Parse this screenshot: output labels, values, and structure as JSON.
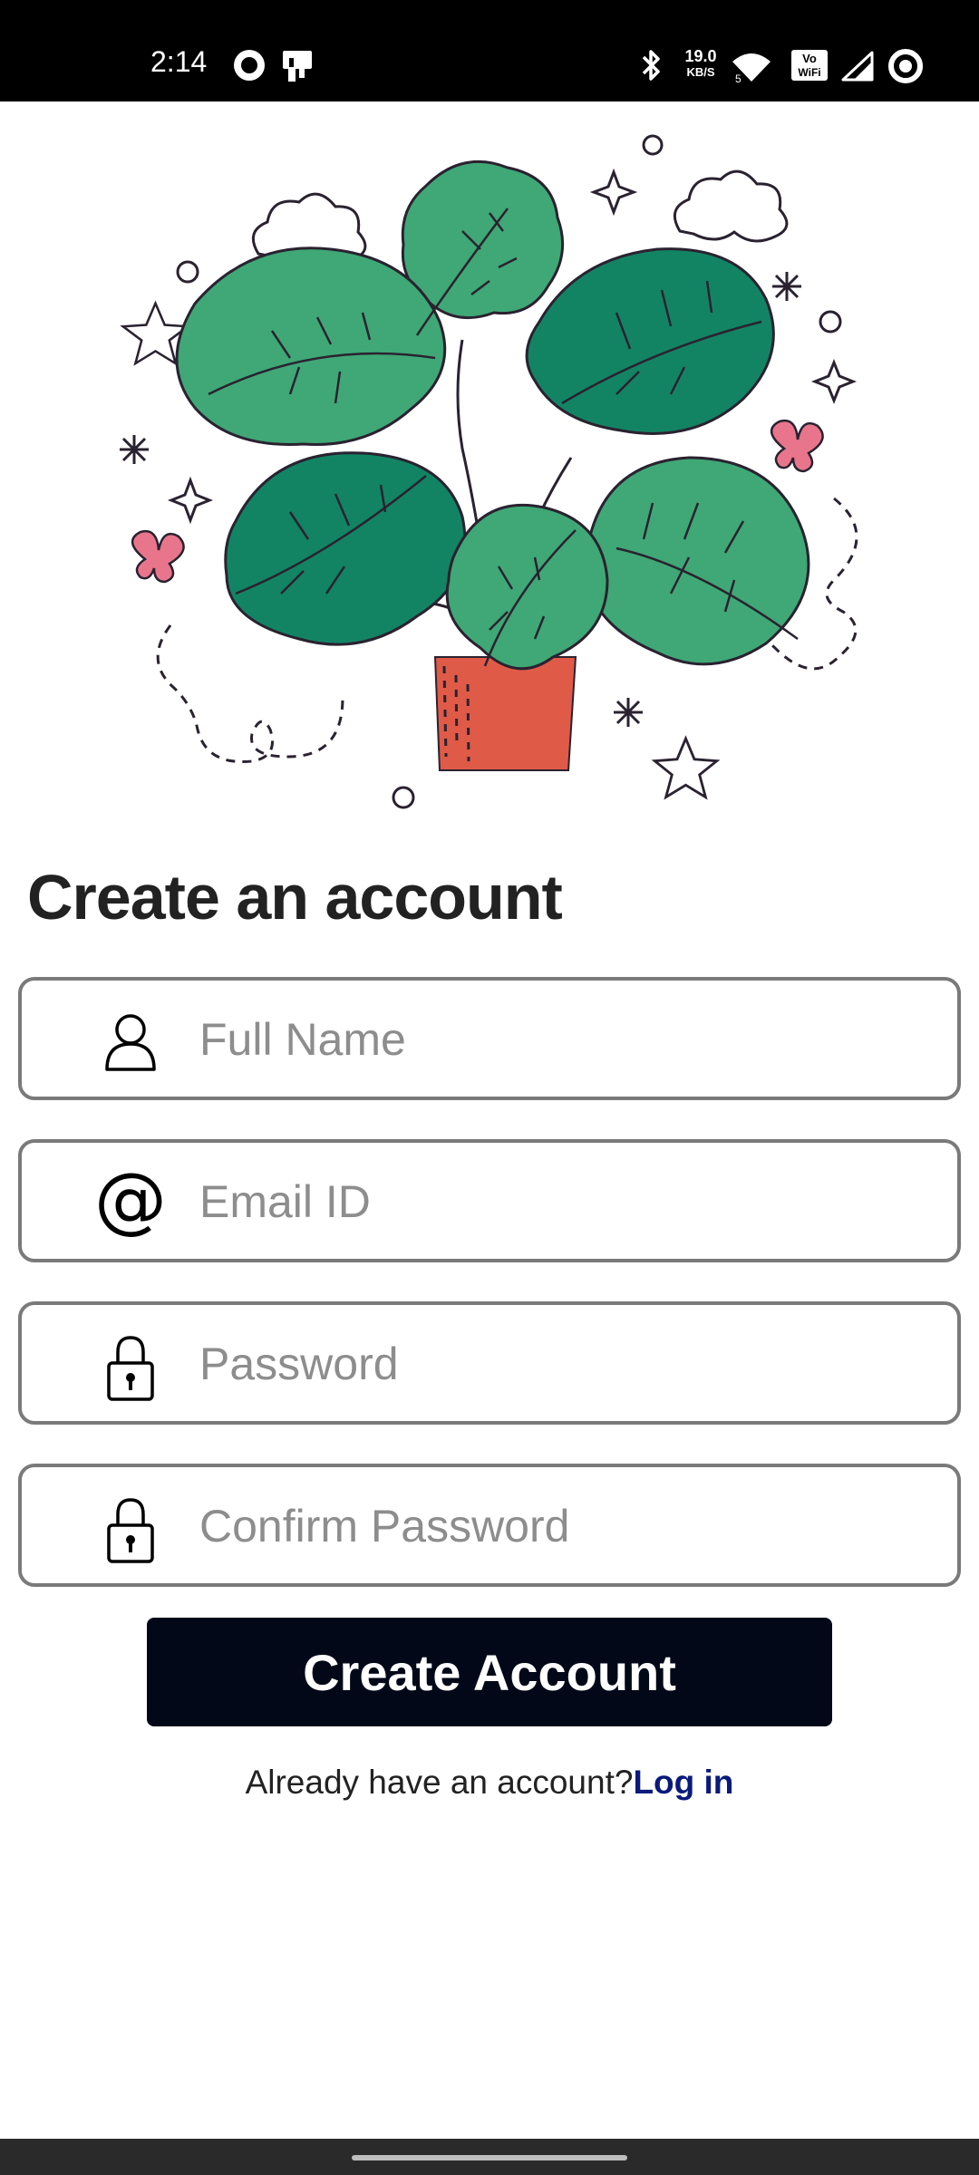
{
  "status_bar": {
    "time": "2:14",
    "network_speed_value": "19.0",
    "network_speed_unit": "KB/S",
    "icons": [
      "record-icon",
      "cast-icon",
      "bluetooth-icon",
      "wifi-icon",
      "vowifi-icon",
      "signal-icon",
      "battery-icon"
    ],
    "vowifi_top": "Vo",
    "vowifi_bottom": "WiFi"
  },
  "illustration": {
    "icon": "monstera-plant-illustration",
    "colors": {
      "leaf_light": "#3fa876",
      "leaf_dark": "#128464",
      "pot": "#e05a48",
      "butterfly": "#e8758c",
      "line": "#2a2230"
    }
  },
  "form": {
    "title": "Create an account",
    "fields": [
      {
        "icon": "user-icon",
        "placeholder": "Full Name",
        "value": ""
      },
      {
        "icon": "at-sign-icon",
        "placeholder": "Email ID",
        "value": ""
      },
      {
        "icon": "lock-icon",
        "placeholder": "Password",
        "value": ""
      },
      {
        "icon": "lock-icon",
        "placeholder": "Confirm Password",
        "value": ""
      }
    ],
    "submit_label": "Create Account",
    "login_prompt": "Already have an account?",
    "login_link": "Log in"
  },
  "colors": {
    "button_bg": "#020818",
    "link": "#0a1a7a",
    "field_border": "#7a7a7a",
    "placeholder": "#8d8d8d"
  }
}
